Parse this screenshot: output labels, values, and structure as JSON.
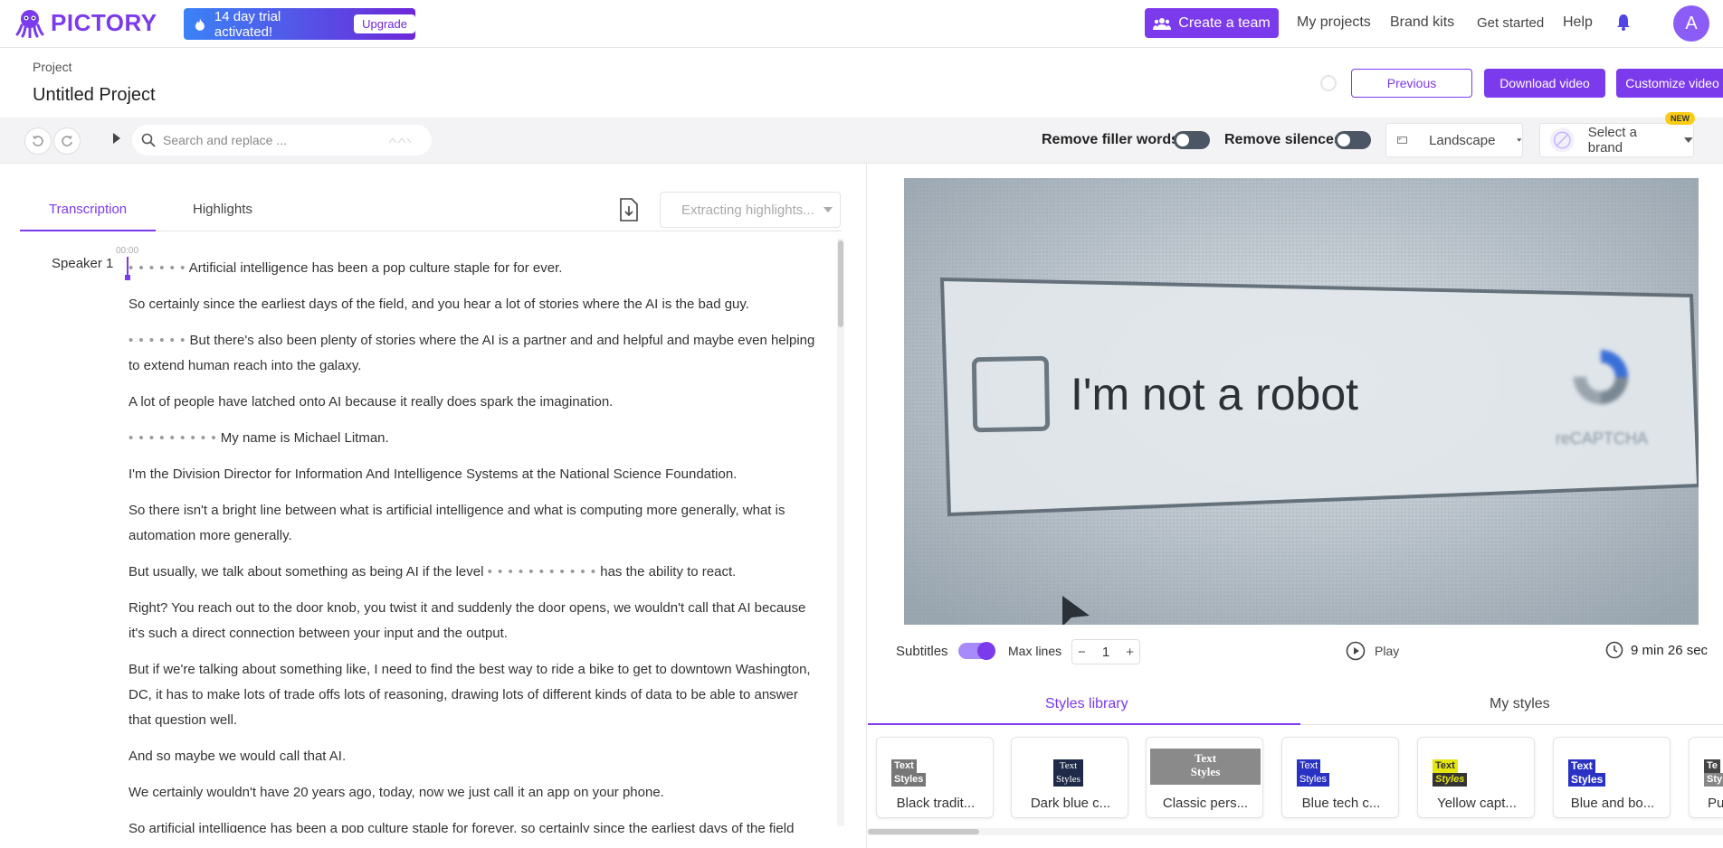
{
  "header": {
    "brand": "PICTORY",
    "trial_text": "14 day trial activated!",
    "upgrade_label": "Upgrade",
    "create_team_label": "Create a team",
    "nav": [
      "My projects",
      "Brand kits",
      "Get started",
      "Help"
    ],
    "avatar_initial": "A"
  },
  "project": {
    "label": "Project",
    "title": "Untitled Project",
    "previous_label": "Previous",
    "download_label": "Download video",
    "customize_label": "Customize video"
  },
  "toolbar": {
    "search_placeholder": "Search and replace ...",
    "remove_filler_label": "Remove filler words",
    "remove_silences_label": "Remove silences",
    "orientation": "Landscape",
    "brand_select": "Select a brand",
    "new_badge": "NEW"
  },
  "left_panel": {
    "tabs": [
      "Transcription",
      "Highlights"
    ],
    "extract_label": "Extracting highlights...",
    "speaker": "Speaker 1",
    "timestamp": "00:00",
    "paragraphs": [
      {
        "dots": "• • • • • •",
        "text": " Artificial intelligence has been a pop culture staple for for ever."
      },
      {
        "text": "So certainly since the earliest days of the field, and you hear a lot of stories where the AI is the bad guy."
      },
      {
        "dots": "• • • • • •",
        "text": " But there's also been plenty of stories where the AI is a partner and and helpful and maybe even helping to extend human reach into the galaxy."
      },
      {
        "text": "A lot of people have latched onto AI because it really does spark the imagination."
      },
      {
        "dots": "• • • • • • • • •",
        "text": " My name is Michael Litman."
      },
      {
        "text": "I'm the Division Director for Information And Intelligence Systems at the National Science Foundation."
      },
      {
        "text": "So there isn't a bright line between what is artificial intelligence and what is computing more generally, what is automation more generally."
      },
      {
        "text_before": "But usually, we talk about something as being AI if the level ",
        "dots": "• • • • • • • • • • •",
        "text": " has the ability to react."
      },
      {
        "text": "Right? You reach out to the door knob, you twist it and suddenly the door opens, we wouldn't call that AI because it's such a direct connection between your input and the output."
      },
      {
        "text": "But if we're talking about something like, I need to find the best way to ride a bike to get to downtown Washington, DC, it has to make lots of trade offs lots of reasoning, drawing lots of different kinds of data to be able to answer that question well."
      },
      {
        "text": "And so maybe we would call that AI."
      },
      {
        "text": "We certainly wouldn't have 20 years ago, today, now we just call it an app on your phone."
      },
      {
        "text": "So artificial intelligence has been a pop culture staple for forever, so certainly since the earliest days of the field"
      }
    ]
  },
  "preview": {
    "video_text": "I'm not a robot",
    "recaptcha_text": "reCAPTCHA",
    "subtitles_label": "Subtitles",
    "max_lines_label": "Max lines",
    "max_lines_value": "1",
    "play_label": "Play",
    "duration": "9 min 26 sec"
  },
  "styles": {
    "tabs": [
      "Styles library",
      "My styles"
    ],
    "cards": [
      {
        "name": "Black tradit...",
        "thumb_l1": "Text",
        "thumb_l2": "Styles"
      },
      {
        "name": "Dark blue c...",
        "thumb_l1": "Text",
        "thumb_l2": "Styles"
      },
      {
        "name": "Classic pers...",
        "thumb_l1": "Text",
        "thumb_l2": "Styles"
      },
      {
        "name": "Blue tech c...",
        "thumb_l1": "Text",
        "thumb_l2": "Styles"
      },
      {
        "name": "Yellow capt...",
        "thumb_l1": "Text",
        "thumb_l2": "Styles"
      },
      {
        "name": "Blue and bo...",
        "thumb_l1": "Text",
        "thumb_l2": "Styles"
      },
      {
        "name": "Pu",
        "thumb_l1": "Te",
        "thumb_l2": "Sty"
      }
    ]
  },
  "colors": {
    "accent": "#7c3aed",
    "trial_gradient_start": "#3b82f6",
    "trial_gradient_end": "#6d28d9"
  }
}
